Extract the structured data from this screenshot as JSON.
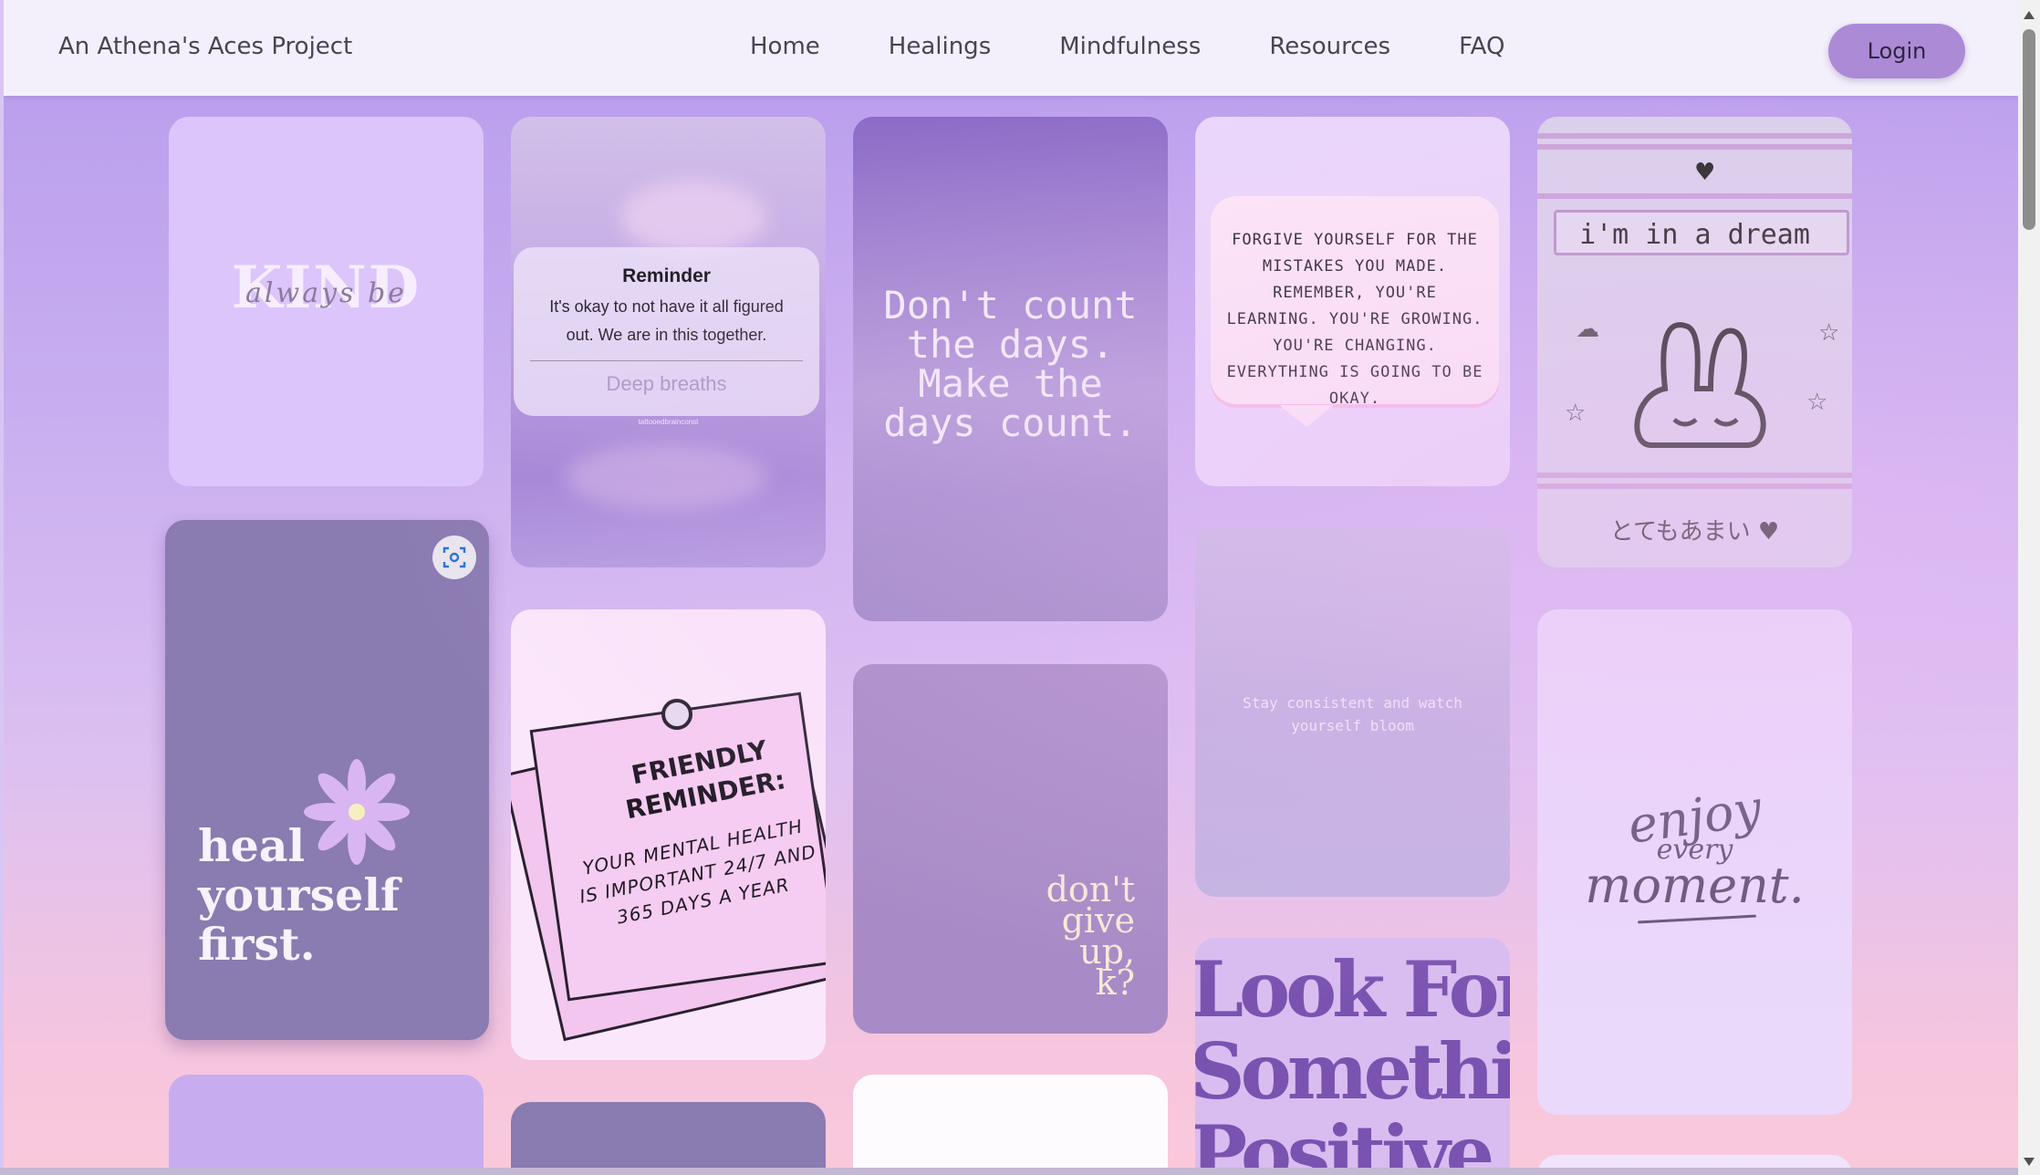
{
  "header": {
    "brand": "An Athena's Aces Project",
    "nav": [
      "Home",
      "Healings",
      "Mindfulness",
      "Resources",
      "FAQ"
    ],
    "login_label": "Login"
  },
  "cards": {
    "kind": {
      "word": "KIND",
      "script": "always be"
    },
    "reminder": {
      "title": "Reminder",
      "text": "It's okay to not have it all figured out. We are in this together.",
      "action": "Deep breaths",
      "credit": "tattooedbrainconst"
    },
    "days": {
      "text": "Don't count the days. Make the days count."
    },
    "forgive": {
      "text": "Forgive yourself for the mistakes you made. Remember, you're learning. You're growing. You're changing. Everything is going to be okay."
    },
    "dream": {
      "text": "i'm in a dream",
      "jp": "とてもあまい ♥"
    },
    "heal": {
      "line1": "heal",
      "line2": "yourself",
      "line3": "first."
    },
    "friendly": {
      "title": "FRIENDLY REMINDER:",
      "body": "YOUR MENTAL HEALTH IS IMPORTANT 24/7 AND 365 DAYS A YEAR"
    },
    "giveup": {
      "line1": "don't",
      "line2": "give",
      "line3": "up,",
      "line4": "k?"
    },
    "bloom": {
      "text": "Stay consistent and watch yourself bloom"
    },
    "enjoy": {
      "line1": "enjoy",
      "line2": "every",
      "line3": "moment."
    },
    "look": {
      "line1": "Look For",
      "line2": "Something",
      "line3": "Positive In"
    }
  },
  "icons": {
    "lens": "visual-search-icon",
    "heart": "heart-icon",
    "flower": "daisy-icon",
    "star": "star-icon"
  },
  "colors": {
    "navbar_bg": "#f4f0fb",
    "login_bg": "#ac8ad6",
    "page_gradient_top": "#b79bec",
    "page_gradient_bottom": "#f9c9db"
  }
}
